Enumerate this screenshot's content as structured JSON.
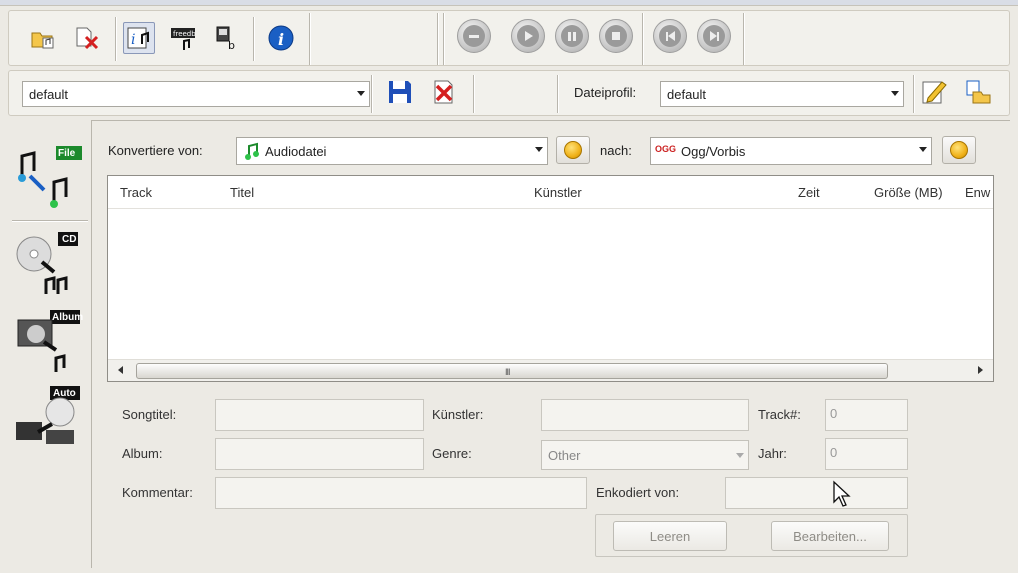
{
  "toolbar": {
    "left_icons": [
      "open-file-icon",
      "remove-file-icon",
      "audio-info-icon",
      "freedb-icon",
      "script-icon",
      "info-icon"
    ],
    "media_icons": [
      "eject-icon",
      "play-icon",
      "pause-icon",
      "stop-icon",
      "previous-icon",
      "next-icon"
    ]
  },
  "profile_bar": {
    "profile_value": "default",
    "dateiprofil_label": "Dateiprofil:",
    "dateiprofil_value": "default"
  },
  "sidebar": {
    "items": [
      {
        "badge": "File",
        "icon": "file-convert-icon"
      },
      {
        "badge": "CD",
        "icon": "cd-rip-icon"
      },
      {
        "badge": "Album",
        "icon": "album-icon"
      },
      {
        "badge": "Auto",
        "icon": "auto-icon"
      }
    ]
  },
  "convert": {
    "from_label": "Konvertiere von:",
    "from_value": "Audiodatei",
    "to_label": "nach:",
    "to_value": "Ogg/Vorbis",
    "to_badge": "OGG"
  },
  "table": {
    "columns": [
      "Track",
      "Titel",
      "Künstler",
      "Zeit",
      "Größe (MB)",
      "Enw"
    ],
    "rows": [],
    "scroll_grip": "III"
  },
  "tags": {
    "songtitel_label": "Songtitel:",
    "kuenstler_label": "Künstler:",
    "track_label": "Track#:",
    "track_value": "0",
    "album_label": "Album:",
    "genre_label": "Genre:",
    "genre_value": "Other",
    "jahr_label": "Jahr:",
    "jahr_value": "0",
    "kommentar_label": "Kommentar:",
    "enkodiert_label": "Enkodiert von:"
  },
  "buttons": {
    "leeren": "Leeren",
    "bearbeiten": "Bearbeiten..."
  },
  "colors": {
    "window_bg": "#eceae4",
    "info_blue": "#1a5fc4",
    "delete_red": "#d42020",
    "save_blue": "#1f4fb8",
    "coin_gold": "#f0b21a"
  }
}
